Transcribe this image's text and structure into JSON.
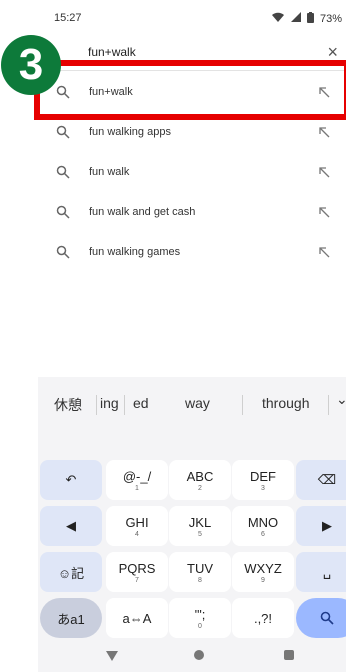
{
  "status_bar": {
    "time": "15:27",
    "battery": "73%"
  },
  "search": {
    "query": "fun+walk",
    "close_icon": "close-icon"
  },
  "suggestions": [
    {
      "text": "fun+walk"
    },
    {
      "text": "fun walking apps"
    },
    {
      "text": "fun walk"
    },
    {
      "text": "fun walk and get cash"
    },
    {
      "text": "fun walking games"
    }
  ],
  "badge": {
    "label": "3"
  },
  "keyboard": {
    "suggestions": [
      "休憩",
      "ing",
      "ed",
      "way",
      "through"
    ],
    "keys": {
      "undo": "↶",
      "at": "@-_/",
      "at_sub": "1",
      "abc": "ABC",
      "abc_sub": "2",
      "def": "DEF",
      "def_sub": "3",
      "backspace": "⌫",
      "left": "◀",
      "ghi": "GHI",
      "ghi_sub": "4",
      "jkl": "JKL",
      "jkl_sub": "5",
      "mno": "MNO",
      "mno_sub": "6",
      "right": "▶",
      "emoji": "☺記",
      "pqrs": "PQRS",
      "pqrs_sub": "7",
      "tuv": "TUV",
      "tuv_sub": "8",
      "wxyz": "WXYZ",
      "wxyz_sub": "9",
      "space": "␣",
      "mode": "あa1",
      "aa": "a⇔A",
      "quote": "'\";",
      "quote_sub": "0",
      "punct": ".,?!",
      "search": "🔍"
    }
  },
  "colors": {
    "accent": "#dfe6f7",
    "badge": "#0d7a3a",
    "highlight": "#e60000"
  }
}
